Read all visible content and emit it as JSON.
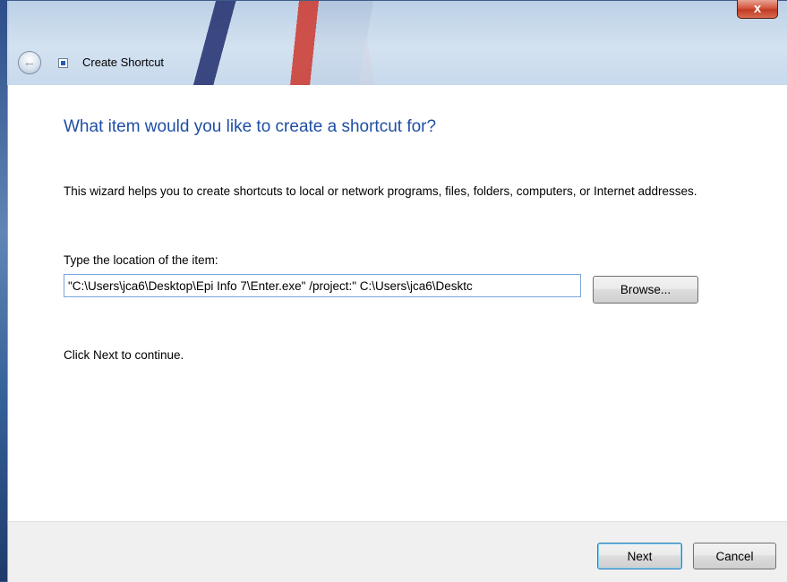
{
  "window": {
    "title": "Create Shortcut",
    "close_label": "x"
  },
  "wizard": {
    "heading": "What item would you like to create a shortcut for?",
    "description": "This wizard helps you to create shortcuts to local or network programs, files, folders, computers, or Internet addresses.",
    "location_label": "Type the location of the item:",
    "location_value": "\"C:\\Users\\jca6\\Desktop\\Epi Info 7\\Enter.exe\" /project:\" C:\\Users\\jca6\\Desktc",
    "browse_label": "Browse...",
    "continue_text": "Click Next to continue."
  },
  "footer": {
    "next_label": "Next",
    "cancel_label": "Cancel"
  },
  "icons": {
    "back": "back-arrow-icon",
    "shortcut": "shortcut-icon",
    "close": "close-icon"
  },
  "colors": {
    "heading": "#1f4ea3",
    "close_button": "#c13a21",
    "input_border": "#7aa7d9"
  }
}
